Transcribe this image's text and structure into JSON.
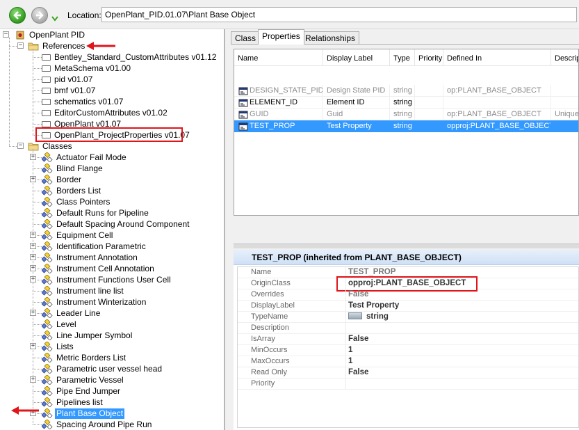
{
  "location": {
    "label": "Location:",
    "value": "OpenPlant_PID.01.07\\Plant Base Object"
  },
  "tree": {
    "root": "OpenPlant PID",
    "references_label": "References",
    "references": [
      "Bentley_Standard_CustomAttributes v01.12",
      "MetaSchema v01.00",
      "pid v01.07",
      "bmf v01.07",
      "schematics v01.07",
      "EditorCustomAttributes v01.02",
      "OpenPlant v01.07",
      "OpenPlant_ProjectProperties v01.07"
    ],
    "classes_label": "Classes",
    "classes": [
      {
        "label": "Actuator Fail Mode",
        "expandable": true
      },
      {
        "label": "Blind Flange",
        "expandable": false
      },
      {
        "label": "Border",
        "expandable": true
      },
      {
        "label": "Borders List",
        "expandable": false
      },
      {
        "label": "Class Pointers",
        "expandable": false
      },
      {
        "label": "Default Runs for Pipeline",
        "expandable": false
      },
      {
        "label": "Default Spacing Around Component",
        "expandable": false
      },
      {
        "label": "Equipment Cell",
        "expandable": true
      },
      {
        "label": "Identification Parametric",
        "expandable": true
      },
      {
        "label": "Instrument Annotation",
        "expandable": true
      },
      {
        "label": "Instrument Cell Annotation",
        "expandable": true
      },
      {
        "label": "Instrument Functions User Cell",
        "expandable": true
      },
      {
        "label": "Instrument line list",
        "expandable": false
      },
      {
        "label": "Instrument Winterization",
        "expandable": false
      },
      {
        "label": "Leader Line",
        "expandable": true
      },
      {
        "label": "Level",
        "expandable": false
      },
      {
        "label": "Line Jumper Symbol",
        "expandable": false
      },
      {
        "label": "Lists",
        "expandable": true
      },
      {
        "label": "Metric Borders List",
        "expandable": false
      },
      {
        "label": "Parametric user vessel head",
        "expandable": false
      },
      {
        "label": "Parametric Vessel",
        "expandable": true
      },
      {
        "label": "Pipe End Jumper",
        "expandable": false
      },
      {
        "label": "Pipelines list",
        "expandable": false
      },
      {
        "label": "Plant Base Object",
        "expandable": true,
        "selected": true
      },
      {
        "label": "Spacing Around Pipe Run",
        "expandable": false
      }
    ]
  },
  "tabs": [
    "Class",
    "Properties",
    "Relationships"
  ],
  "active_tab": "Properties",
  "grid": {
    "columns": [
      "Name",
      "Display Label",
      "Type",
      "Priority",
      "Defined In",
      "Descrip"
    ],
    "rows": [
      {
        "name": "DESIGN_STATE_PID",
        "display_label": "Design State PID",
        "type": "string",
        "priority": "",
        "defined_in": "op:PLANT_BASE_OBJECT",
        "description": "",
        "style": "gray"
      },
      {
        "name": "ELEMENT_ID",
        "display_label": "Element ID",
        "type": "string",
        "priority": "",
        "defined_in": "",
        "description": "",
        "style": "normal"
      },
      {
        "name": "GUID",
        "display_label": "Guid",
        "type": "string",
        "priority": "",
        "defined_in": "op:PLANT_BASE_OBJECT",
        "description": "Unique",
        "style": "gray"
      },
      {
        "name": "TEST_PROP",
        "display_label": "Test Property",
        "type": "string",
        "priority": "",
        "defined_in": "opproj:PLANT_BASE_OBJECT",
        "description": "",
        "style": "selected"
      }
    ]
  },
  "details": {
    "title": "TEST_PROP (inherited from PLANT_BASE_OBJECT)",
    "properties": [
      {
        "name": "Name",
        "value": "TEST_PROP",
        "style": "gray"
      },
      {
        "name": "OriginClass",
        "value": "opproj:PLANT_BASE_OBJECT",
        "style": "normal"
      },
      {
        "name": "Overrides",
        "value": "False",
        "style": "gray"
      },
      {
        "name": "DisplayLabel",
        "value": "Test Property",
        "style": "normal"
      },
      {
        "name": "TypeName",
        "value": "string",
        "style": "normal",
        "icon": "type-icon"
      },
      {
        "name": "Description",
        "value": "",
        "style": "normal"
      },
      {
        "name": "IsArray",
        "value": "False",
        "style": "normal"
      },
      {
        "name": "MinOccurs",
        "value": "1",
        "style": "normal"
      },
      {
        "name": "MaxOccurs",
        "value": "1",
        "style": "normal"
      },
      {
        "name": "Read Only",
        "value": "False",
        "style": "normal"
      },
      {
        "name": "Priority",
        "value": "",
        "style": "normal"
      }
    ]
  },
  "colors": {
    "selection": "#3399ff",
    "annotation_red": "#e0151a",
    "back_button": "#2f9a1c"
  },
  "icons": [
    "back-arrow-icon",
    "forward-arrow-icon",
    "dropdown-arrow-icon",
    "schema-icon",
    "references-folder-icon",
    "reference-icon",
    "classes-folder-icon",
    "class-icon",
    "property-icon",
    "type-icon"
  ]
}
